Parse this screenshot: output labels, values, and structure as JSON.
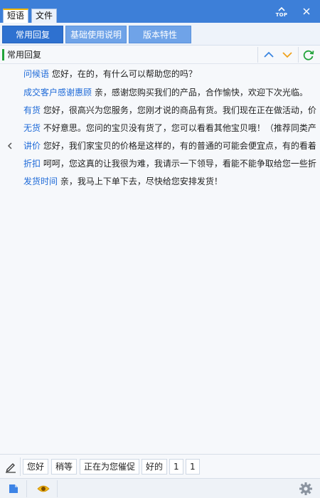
{
  "titlebar": {
    "tabs": [
      {
        "label": "短语",
        "active": true
      },
      {
        "label": "文件",
        "active": false
      }
    ],
    "top_label": "TOP"
  },
  "toolbar": {
    "buttons": [
      {
        "label": "常用回复",
        "active": true
      },
      {
        "label": "基础使用说明",
        "active": false
      },
      {
        "label": "版本特性",
        "active": false
      }
    ]
  },
  "section": {
    "title": "常用回复"
  },
  "phrases": [
    {
      "key": "问候语",
      "text": "您好，在的，有什么可以帮助您的吗？"
    },
    {
      "key": "成交客户感谢惠顾",
      "text": "亲，感谢您购买我们的产品，合作愉快，欢迎下次光临。"
    },
    {
      "key": "有货",
      "text": "您好，很高兴为您服务，您刚才说的商品有货。我们现在正在做活动，价"
    },
    {
      "key": "无货",
      "text": "不好意思。您问的宝贝没有货了，您可以看看其他宝贝哦！（推荐同类产"
    },
    {
      "key": "讲价",
      "text": "您好，我们家宝贝的价格是这样的，有的普通的可能会便宜点，有的看着"
    },
    {
      "key": "折扣",
      "text": "呵呵，您这真的让我很为难，我请示一下领导，看能不能争取给您一些折"
    },
    {
      "key": "发货时间",
      "text": "亲，我马上下单下去，尽快给您安排发货！"
    }
  ],
  "quickbar": {
    "buttons": [
      "您好",
      "稍等",
      "正在为您催促",
      "好的",
      "1",
      "1"
    ]
  },
  "colors": {
    "titlebar": "#3d7fd8",
    "accent_button": "#2e71d0",
    "inactive_button": "#6fa3e8",
    "link_key": "#1e6ad8",
    "section_bar": "#22a33a"
  },
  "icons": {
    "top": "top-arrow-icon",
    "close": "close-icon",
    "up": "chevron-up-icon",
    "down": "chevron-down-icon",
    "refresh": "refresh-icon",
    "collapse": "chevron-left-icon",
    "pen": "pen-icon",
    "doc": "document-icon",
    "eye": "eye-icon",
    "gear": "gear-icon"
  }
}
